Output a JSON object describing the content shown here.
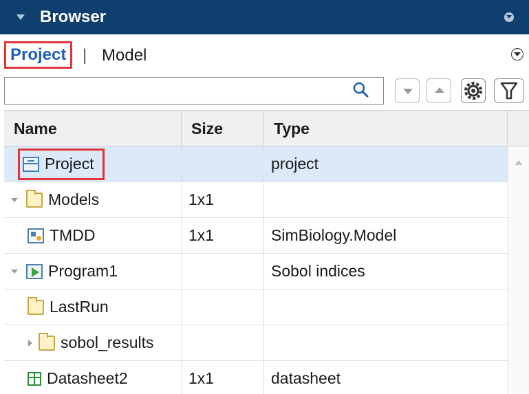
{
  "titlebar": {
    "title": "Browser"
  },
  "tabs": {
    "project": "Project",
    "separator": "|",
    "model": "Model"
  },
  "search": {
    "value": "",
    "placeholder": ""
  },
  "table": {
    "headers": {
      "name": "Name",
      "size": "Size",
      "type": "Type"
    },
    "rows": [
      {
        "name": "Project",
        "size": "",
        "type": "project",
        "icon": "project-icon",
        "selected": true
      },
      {
        "name": "Models",
        "size": "1x1",
        "type": "",
        "icon": "folder-icon",
        "expander": "open"
      },
      {
        "name": "TMDD",
        "size": "1x1",
        "type": "SimBiology.Model",
        "icon": "model-icon"
      },
      {
        "name": "Program1",
        "size": "",
        "type": "Sobol indices",
        "icon": "program-icon",
        "expander": "open"
      },
      {
        "name": "LastRun",
        "size": "",
        "type": "",
        "icon": "folder-icon"
      },
      {
        "name": "sobol_results",
        "size": "",
        "type": "",
        "icon": "folder-icon",
        "expander": "closed"
      },
      {
        "name": "Datasheet2",
        "size": "1x1",
        "type": "datasheet",
        "icon": "datasheet-icon"
      }
    ]
  },
  "colors": {
    "titlebar": "#0e3f6e",
    "highlight": "#e3343a",
    "selected_row": "#dbe9f8",
    "active_tab": "#1f5fb5"
  }
}
